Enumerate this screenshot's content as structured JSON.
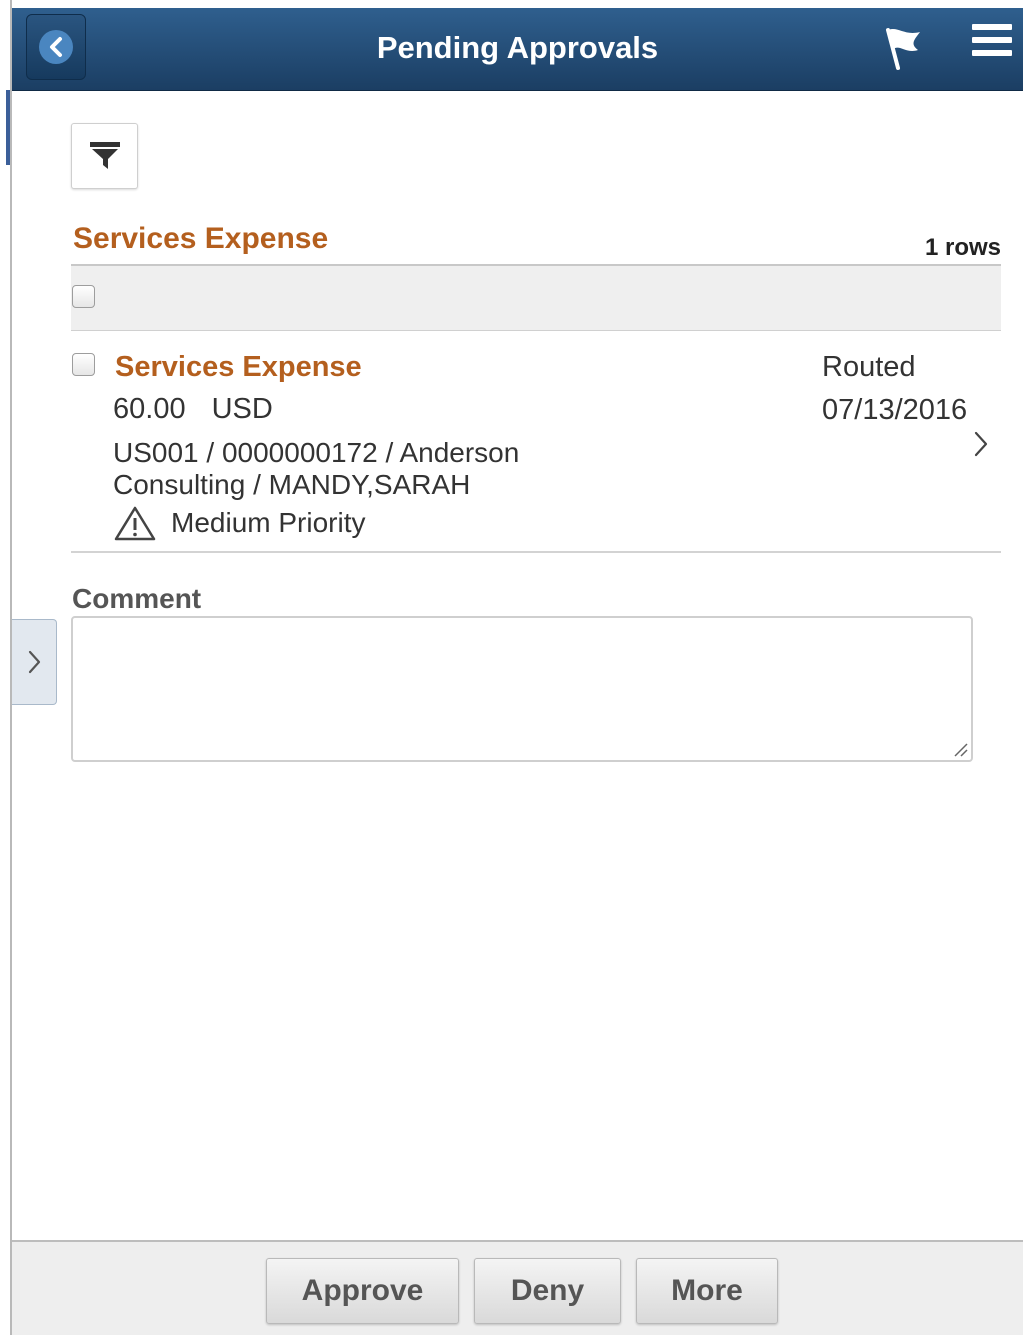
{
  "header": {
    "title": "Pending Approvals",
    "back_icon": "chevron-left-icon",
    "flag_icon": "flag-icon",
    "menu_icon": "hamburger-menu-icon",
    "background": "#1f4a74"
  },
  "filter": {
    "icon": "funnel-filter-icon"
  },
  "list": {
    "title": "Services Expense",
    "row_count": "1 rows",
    "items": [
      {
        "title": "Services Expense",
        "amount": "60.00",
        "currency": "USD",
        "description": "US001 / 0000000172 / Anderson Consulting / MANDY,SARAH",
        "priority": "Medium Priority",
        "status": "Routed",
        "date": "07/13/2016",
        "checked": false
      }
    ]
  },
  "comment": {
    "label": "Comment",
    "value": ""
  },
  "footer": {
    "approve_label": "Approve",
    "deny_label": "Deny",
    "more_label": "More"
  },
  "colors": {
    "accent": "#b45f1e",
    "header": "#1f4a74"
  }
}
